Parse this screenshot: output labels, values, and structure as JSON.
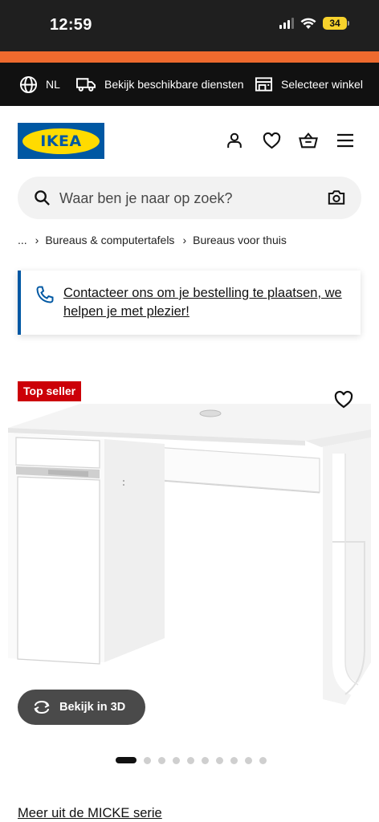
{
  "status_bar": {
    "time": "12:59",
    "battery": "34"
  },
  "topnav": {
    "language": "NL",
    "services": "Bekijk beschikbare diensten",
    "store": "Selecteer winkel"
  },
  "header": {
    "logo_text": "IKEA",
    "icons": [
      "user-icon",
      "heart-icon",
      "basket-icon",
      "menu-icon"
    ]
  },
  "search": {
    "placeholder": "Waar ben je naar op zoek?"
  },
  "breadcrumb": {
    "ellipsis": "...",
    "items": [
      "Bureaus & computertafels",
      "Bureaus voor thuis"
    ]
  },
  "contact_card": {
    "text": "Contacteer ons om je bestelling te plaatsen, we helpen je met plezier!"
  },
  "product": {
    "badge": "Top seller",
    "view_3d": "Bekijk in 3D",
    "image_count": 10,
    "active_image": 0
  },
  "series_link": "Meer uit de MICKE serie",
  "colors": {
    "ikea_blue": "#0058a3",
    "ikea_yellow": "#ffdb00",
    "top_seller_red": "#cc0008",
    "orange_stripe": "#ee6a2e"
  }
}
